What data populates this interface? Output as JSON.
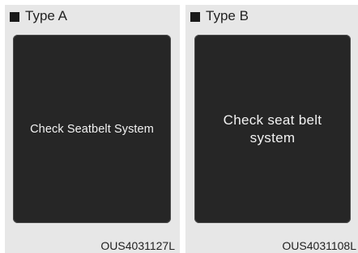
{
  "panels": [
    {
      "label": "Type A",
      "message": "Check Seatbelt System",
      "code": "OUS4031127L"
    },
    {
      "label": "Type B",
      "message": "Check seat belt system",
      "code": "OUS4031108L"
    }
  ],
  "colors": {
    "panel_bg": "#e7e7e7",
    "screen_bg": "#262626",
    "screen_text": "#f2f2f2"
  }
}
